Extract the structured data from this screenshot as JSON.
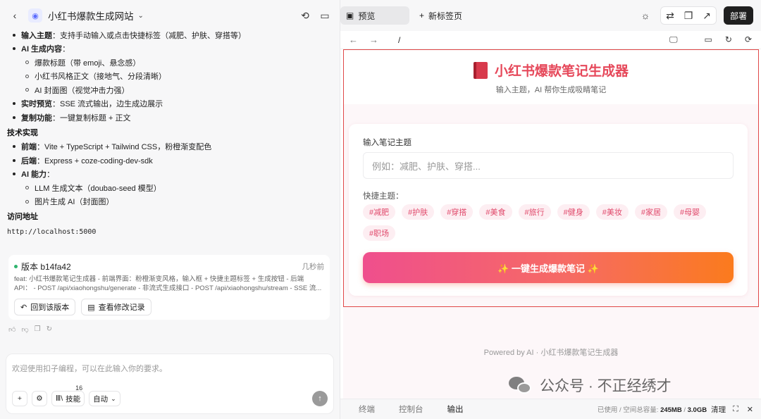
{
  "left": {
    "title": "小红书爆款生成网站",
    "chat": {
      "items": [
        {
          "type": "bullet",
          "bold": "输入主题",
          "text": "：支持手动输入或点击快捷标签（减肥、护肤、穿搭等）"
        },
        {
          "type": "bullet",
          "bold": "AI 生成内容",
          "text": "："
        },
        {
          "type": "sub",
          "text": "爆款标题（带 emoji、悬念感）"
        },
        {
          "type": "sub",
          "text": "小红书风格正文（接地气、分段清晰）"
        },
        {
          "type": "sub",
          "text": "AI 封面图（视觉冲击力强）"
        },
        {
          "type": "bullet",
          "bold": "实时预览",
          "text": "：SSE 流式输出，边生成边展示"
        },
        {
          "type": "bullet",
          "bold": "复制功能",
          "text": "：一键复制标题 + 正文"
        }
      ],
      "tech_heading": "技术实现",
      "tech": [
        {
          "type": "bullet",
          "bold": "前端",
          "text": "：Vite + TypeScript + Tailwind CSS，粉橙渐变配色"
        },
        {
          "type": "bullet",
          "bold": "后端",
          "text": "：Express + coze-coding-dev-sdk"
        },
        {
          "type": "bullet",
          "bold": "AI 能力",
          "text": "："
        },
        {
          "type": "sub",
          "text": "LLM 生成文本（doubao-seed 模型）"
        },
        {
          "type": "sub",
          "text": "图片生成 AI（封面图）"
        }
      ],
      "access_heading": "访问地址",
      "access_url": "http://localhost:5000"
    },
    "version": {
      "label": "版本 b14fa42",
      "time": "几秒前",
      "desc1": "feat: 小红书爆款笔记生成器 - 前端界面：粉橙渐变风格，输入框 + 快捷主题标签 + 生成按钮 - 后端",
      "desc2": "API： - POST /api/xiaohongshu/generate - 非流式生成接口 - POST /api/xiaohongshu/stream - SSE 流...",
      "rollback": "回到该版本",
      "history": "查看修改记录"
    },
    "composer": {
      "placeholder": "欢迎使用扣子编程，可以在此输入你的要求。",
      "skills": "技能",
      "skills_count": "16",
      "mode": "自动"
    }
  },
  "right": {
    "tab_preview": "预览",
    "tab_new": "新标签页",
    "deploy": "部署",
    "path": "/",
    "app": {
      "title": "小红书爆款笔记生成器",
      "subtitle": "输入主题，AI 帮你生成吸睛笔记",
      "input_label": "输入笔记主题",
      "input_placeholder": "例如：减肥、护肤、穿搭...",
      "quick_label": "快捷主题：",
      "tags": [
        "#减肥",
        "#护肤",
        "#穿搭",
        "#美食",
        "#旅行",
        "#健身",
        "#美妆",
        "#家居",
        "#母婴",
        "#职场"
      ],
      "generate": "✨ 一键生成爆款笔记 ✨",
      "footer": "Powered by AI · 小红书爆款笔记生成器"
    },
    "bottom": {
      "tabs": [
        "终端",
        "控制台",
        "输出"
      ],
      "active": "输出",
      "storage_prefix": "已使用 / 空间总容量: ",
      "used": "245MB",
      "sep": " / ",
      "total": "3.0GB",
      "clear": "清理"
    }
  },
  "watermark": "公众号 · 不正经绣才",
  "colors": {
    "accent_pink": "#ef4f8d",
    "accent_orange": "#fb7b1d",
    "title_red": "#e6485a",
    "selection": "#e04848"
  }
}
